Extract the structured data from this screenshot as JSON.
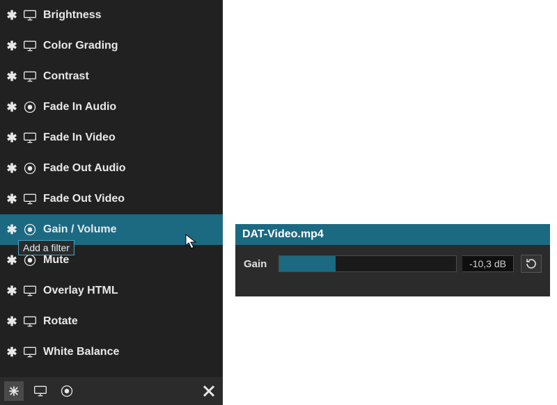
{
  "filters": {
    "tooltip": "Add a filter",
    "items": [
      {
        "label": "Brightness",
        "icon": "monitor",
        "selected": false
      },
      {
        "label": "Color Grading",
        "icon": "monitor",
        "selected": false
      },
      {
        "label": "Contrast",
        "icon": "monitor",
        "selected": false
      },
      {
        "label": "Fade In Audio",
        "icon": "audio",
        "selected": false
      },
      {
        "label": "Fade In Video",
        "icon": "monitor",
        "selected": false
      },
      {
        "label": "Fade Out Audio",
        "icon": "audio",
        "selected": false
      },
      {
        "label": "Fade Out Video",
        "icon": "monitor",
        "selected": false
      },
      {
        "label": "Gain / Volume",
        "icon": "audio",
        "selected": true
      },
      {
        "label": "Mute",
        "icon": "audio",
        "selected": false
      },
      {
        "label": "Overlay HTML",
        "icon": "monitor",
        "selected": false
      },
      {
        "label": "Rotate",
        "icon": "monitor",
        "selected": false
      },
      {
        "label": "White Balance",
        "icon": "monitor",
        "selected": false
      }
    ]
  },
  "toolbar": {
    "buttons": [
      {
        "name": "favorite",
        "icon": "asterisk",
        "active": true
      },
      {
        "name": "video",
        "icon": "monitor",
        "active": false
      },
      {
        "name": "audio",
        "icon": "audio",
        "active": false
      }
    ]
  },
  "properties": {
    "title": "DAT-Video.mp4",
    "rows": {
      "gain": {
        "label": "Gain",
        "value_text": "-10,3 dB",
        "fill_percent": 32
      }
    }
  }
}
